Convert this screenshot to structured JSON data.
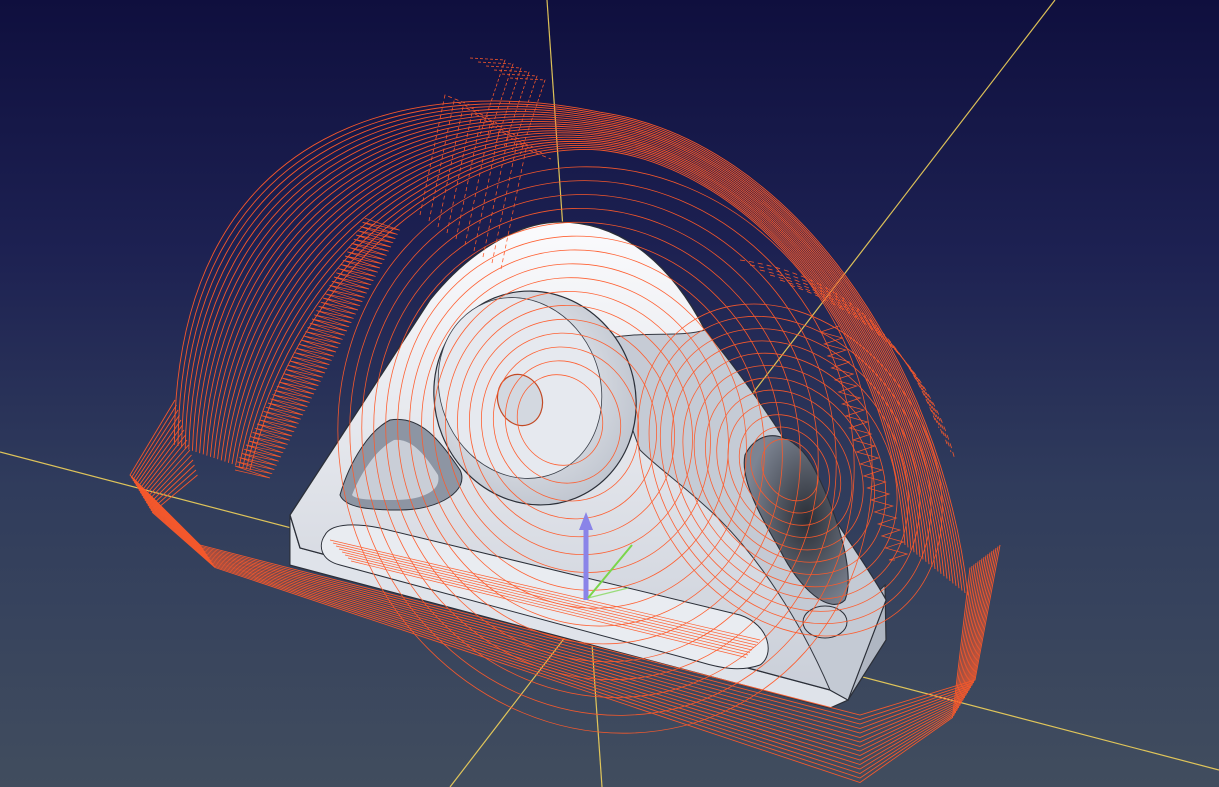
{
  "viewport": {
    "background_top": "#0f0f3e",
    "background_bottom": "#414d5e"
  },
  "colors": {
    "toolpath": "#ff5a2a",
    "axis_lines": "#f2d35a",
    "part_face": "#eef0f4",
    "part_shadow": "#9aa3b0",
    "gizmo_z": "#8a84e8",
    "gizmo_y": "#7ad64a"
  },
  "scene": {
    "object": "machined-part",
    "overlay": "roughing-toolpath",
    "visible_text": []
  }
}
